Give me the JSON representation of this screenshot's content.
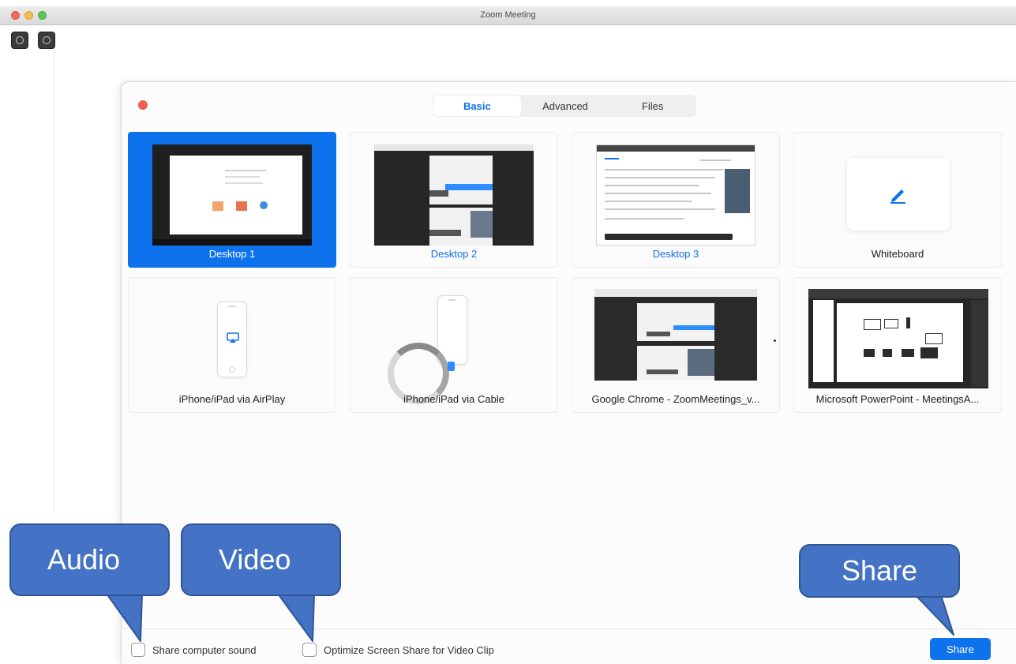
{
  "window": {
    "title": "Zoom Meeting"
  },
  "tabs": [
    {
      "label": "Basic",
      "active": true
    },
    {
      "label": "Advanced",
      "active": false
    },
    {
      "label": "Files",
      "active": false
    }
  ],
  "share_options": [
    {
      "label": "Desktop 1",
      "selected": true
    },
    {
      "label": "Desktop 2",
      "selected": false
    },
    {
      "label": "Desktop 3",
      "selected": false
    },
    {
      "label": "Whiteboard",
      "selected": false
    },
    {
      "label": "iPhone/iPad via AirPlay",
      "selected": false
    },
    {
      "label": "iPhone/iPad via Cable",
      "selected": false
    },
    {
      "label": "Google Chrome - ZoomMeetings_v...",
      "selected": false
    },
    {
      "label": "Microsoft PowerPoint - MeetingsA...",
      "selected": false
    }
  ],
  "bottom_bar": {
    "share_sound_label": "Share computer sound",
    "share_sound_checked": false,
    "optimize_video_label": "Optimize Screen Share for Video Clip",
    "optimize_video_checked": false,
    "share_button_label": "Share"
  },
  "callouts": {
    "audio": "Audio",
    "video": "Video",
    "share": "Share"
  },
  "colors": {
    "accent": "#0e72ed",
    "callout": "#4472c4",
    "close_dot": "#ec5f53"
  },
  "icons": {
    "whiteboard": "pencil-icon",
    "airplay": "airplay-icon"
  }
}
